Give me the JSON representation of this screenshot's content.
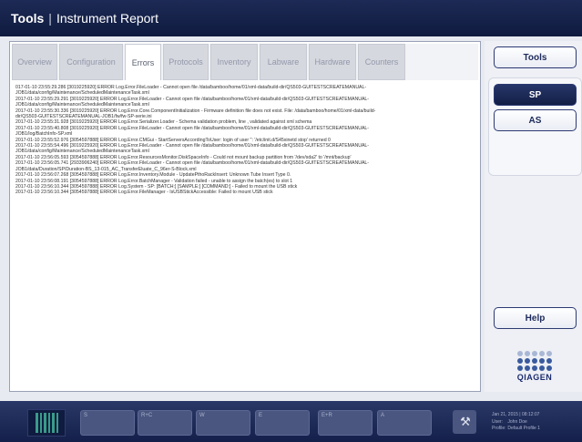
{
  "window": {
    "title_bold": "Tools",
    "separator": "|",
    "title_rest": "Instrument Report"
  },
  "tabs": [
    {
      "label": "Overview",
      "active": false
    },
    {
      "label": "Configuration",
      "active": false
    },
    {
      "label": "Errors",
      "active": true
    },
    {
      "label": "Protocols",
      "active": false
    },
    {
      "label": "Inventory",
      "active": false
    },
    {
      "label": "Labware",
      "active": false
    },
    {
      "label": "Hardware",
      "active": false
    },
    {
      "label": "Counters",
      "active": false
    }
  ],
  "log_lines": [
    "017-01-10 23:55:29.286 [3019225920] ERROR Log.Error.FileLoader - Cannot open file /data/bamboo/home/01/xml-data/build-dir/QS503-GUITESTSCREATEMANUAL-",
    "JOB1/data/config/Maintenance/ScheduledMaintenanceTask.xml",
    "2017-01-10 23:55:29.291 [3019225920] ERROR Log.Error.FileLoader - Cannot open file /data/bamboo/home/01/xml-data/build-dir/QS503-GUITESTSCREATEMANUAL-",
    "JOB1/data/config/Maintenance/ScheduledMaintenanceTask.xml",
    "2017-01-10 23:55:30.336 [3019225920] ERROR Log.Error.Core.ComponentInitialization - Firmware definition file does not exist. File: /data/bamboo/home/01/xml-data/build-",
    "dir/QS503-GUITESTSCREATEMANUAL-JOB1/fw/fw-SP-serie.ini",
    "2017-01-10 23:55:31.928 [3019225920] ERROR Log.Error.Serializer.Loader - Schema validation problem, line , validated against xml schema",
    "2017-01-10 23:55:40.808 [3019225920] ERROR Log.Error.FileLoader - Cannot open file /data/bamboo/home/01/xml-data/build-dir/QS503-GUITESTSCREATEMANUAL-",
    "JOB1/log/BatchInfo-SP.xml",
    "2017-01-10 23:55:52.976 [3054597888] ERROR Log.Error.CMGui - StartServersAccordingToUser: login of user '': '/etc/init.d/S45xinetd stop' returned 0",
    "2017-01-10 23:55:54.496 [3019225920] ERROR Log.Error.FileLoader - Cannot open file /data/bamboo/home/01/xml-data/build-dir/QS503-GUITESTSCREATEMANUAL-",
    "JOB1/data/config/Maintenance/ScheduledMaintenanceTask.xml",
    "2017-01-10 23:56:05.593 [3054597888] ERROR Log.Error.ResourcesMonitor.DiskSpaceInfo - Could not mount backup partition from '/dev/sda2' to '/mnt/backup'",
    "2017-01-10 23:56:05.741 [2933906240] ERROR Log.Error.FileLoader - Cannot open file /data/bamboo/home/01/xml-data/build-dir/QS503-GUITESTSCREATEMANUAL-",
    "JOB1/data/Duration/SP/Duration-BS_13-015_AC_TransferEluate_C_96er-S-Block.xml",
    "2017-01-10 23:56:07.268 [3054597888] ERROR Log.Error.Inventory.Module - UpdatePthoRackInsert: Unknown Tube Insert Type 0.",
    "2017-01-10 23:56:08.191 [3054597888] ERROR Log.Error.BatchManager - Validation failed - unable to assign the batch(es) to slot 1",
    "2017-01-10 23:56:10.344 [3054597888] ERROR Log.System - SP: [BATCH:] [SAMPLE:] [COMMAND:] - Failed to mount the USB stick",
    "2017-01-10 23:56:10.344 [3054597888] ERROR Log.Error.FileManager - IsUSBStickAccessible: Failed to mount USB stick"
  ],
  "sidebar": {
    "tools_label": "Tools",
    "sp_label": "SP",
    "as_label": "AS",
    "help_label": "Help",
    "logo_text": "QIAGEN",
    "logo_dot_color": "#3a5a9e",
    "logo_dot_light": "#a9b7d6"
  },
  "bottom": {
    "buttons": [
      {
        "label": "S"
      },
      {
        "label": "R+C"
      },
      {
        "label": "W"
      },
      {
        "label": "E"
      },
      {
        "label": "E+R"
      },
      {
        "label": "A"
      }
    ],
    "tool_icon": "wrench-screwdriver-icon",
    "status": {
      "datetime": "Jan 21, 2015 | 08:12:07",
      "user_label": "User:",
      "user_value": "John Doe",
      "profile_label": "Profile:",
      "profile_value": "Default Profile 1"
    }
  },
  "colors": {
    "brand_dark": "#14204a",
    "accent": "#2c3a73",
    "barcode_green": "#3a9b8a"
  }
}
